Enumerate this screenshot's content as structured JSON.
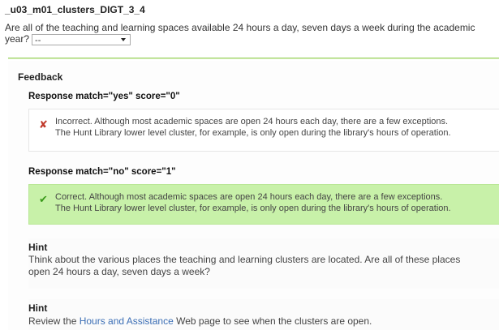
{
  "question": {
    "id": "_u03_m01_clusters_DIGT_3_4",
    "text_line1": "Are all of the teaching and learning spaces available 24 hours a day, seven days a week during the academic",
    "text_line2": "year?",
    "select": {
      "value": "--"
    }
  },
  "feedback": {
    "label": "Feedback",
    "responses": [
      {
        "heading": "Response match=\"yes\" score=\"0\"",
        "icon": "cross-icon",
        "color": "#c0392b",
        "line1": "Incorrect. Although most academic spaces are open 24 hours each day, there are a few exceptions.",
        "line2": "The Hunt Library lower level cluster, for example, is only open during the library's hours of operation."
      },
      {
        "heading": "Response match=\"no\" score=\"1\"",
        "icon": "check-icon",
        "color": "#3a9a1a",
        "line1": "Correct. Although most academic spaces are open 24 hours each day, there are a few exceptions.",
        "line2": "The Hunt Library lower level cluster, for example, is only open during the library's hours of operation."
      }
    ]
  },
  "hints": [
    {
      "title": "Hint",
      "text": "Think about the various places the teaching and learning clusters are located. Are all of these places open 24 hours a day, seven days a week?"
    },
    {
      "title": "Hint",
      "text_before": "Review the ",
      "link_text": "Hours and Assistance",
      "text_after": " Web page to see when the clusters are open."
    }
  ],
  "colors": {
    "correct_bg": "#c8f1a9",
    "link": "#3b6eb5",
    "divider": "#9fd36a"
  }
}
